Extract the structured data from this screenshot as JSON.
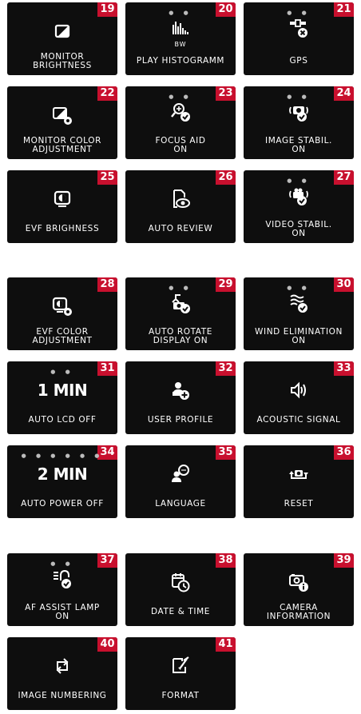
{
  "tiles": [
    {
      "num": "19",
      "label1": "MONITOR",
      "label2": "BRIGHTNESS",
      "icon": "half-square-icon"
    },
    {
      "num": "20",
      "sub": "BW",
      "label1": "PLAY HISTOGRAMM",
      "icon": "histogram-icon"
    },
    {
      "num": "21",
      "label1": "GPS",
      "icon": "gps-satellite-off-icon"
    },
    {
      "num": "22",
      "label1": "MONITOR COLOR",
      "label2": "ADJUSTMENT",
      "icon": "monitor-gear-icon"
    },
    {
      "num": "23",
      "label1": "FOCUS AID",
      "label2": "ON",
      "icon": "focus-aid-icon"
    },
    {
      "num": "24",
      "label1": "IMAGE STABIL.",
      "label2": "ON",
      "icon": "image-stabilizer-icon"
    },
    {
      "num": "25",
      "label1": "EVF BRIGHNESS",
      "icon": "evf-brightness-icon"
    },
    {
      "num": "26",
      "label1": "AUTO REVIEW",
      "icon": "auto-review-eye-icon"
    },
    {
      "num": "27",
      "label1": "VIDEO STABIL.",
      "label2": "ON",
      "icon": "video-stabilizer-icon"
    },
    {
      "num": "28",
      "label1": "EVF COLOR",
      "label2": "ADJUSTMENT",
      "icon": "evf-gear-icon"
    },
    {
      "num": "29",
      "label1": "AUTO ROTATE",
      "label2": "DISPLAY ON",
      "icon": "auto-rotate-icon"
    },
    {
      "num": "30",
      "label1": "WIND ELIMINATION",
      "label2": "ON",
      "icon": "wind-icon"
    },
    {
      "num": "31",
      "big": "1 MIN",
      "label1": "AUTO LCD OFF",
      "icon": "none"
    },
    {
      "num": "32",
      "label1": "USER PROFILE",
      "icon": "user-add-icon"
    },
    {
      "num": "33",
      "label1": "ACOUSTIC SIGNAL",
      "icon": "speaker-icon"
    },
    {
      "num": "34",
      "big": "2 MIN",
      "label1": "AUTO POWER OFF",
      "icon": "none"
    },
    {
      "num": "35",
      "label1": "LANGUAGE",
      "icon": "language-chat-icon"
    },
    {
      "num": "36",
      "label1": "RESET",
      "icon": "reset-icon"
    },
    {
      "num": "37",
      "label1": "AF ASSIST LAMP",
      "label2": "ON",
      "icon": "af-assist-lamp-icon"
    },
    {
      "num": "38",
      "label1": "DATE & TIME",
      "icon": "calendar-clock-icon"
    },
    {
      "num": "39",
      "label1": "CAMERA",
      "label2": "INFORMATION",
      "icon": "camera-info-icon"
    },
    {
      "num": "40",
      "label1": "IMAGE NUMBERING",
      "icon": "numbering-arrows-icon"
    },
    {
      "num": "41",
      "label1": "FORMAT",
      "icon": "format-card-icon"
    }
  ],
  "colors": {
    "tile_bg": "#0e0e0e",
    "badge": "#c8102e",
    "text": "#ffffff"
  }
}
